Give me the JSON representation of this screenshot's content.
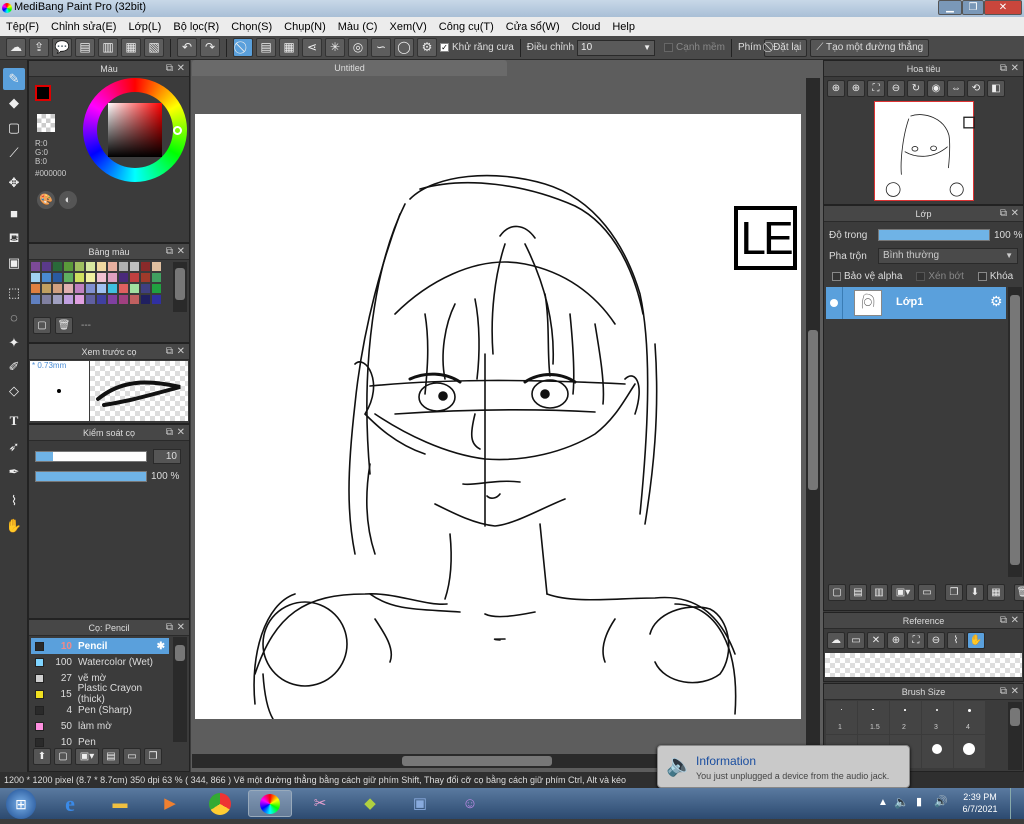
{
  "window": {
    "title": "MediBang Paint Pro (32bit)"
  },
  "menu": [
    "Tệp(F)",
    "Chỉnh sửa(E)",
    "Lớp(L)",
    "Bộ lọc(R)",
    "Chọn(S)",
    "Chụp(N)",
    "Màu (C)",
    "Xem(V)",
    "Công cụ(T)",
    "Cửa sổ(W)",
    "Cloud",
    "Help"
  ],
  "toolbar": {
    "antialias": "Khử răng cưa",
    "adjust_label": "Điều chỉnh",
    "adjust_value": "10",
    "soft_edge": "Cạnh mềm",
    "pen_label": "Phím",
    "reset_label": "Đặt lại",
    "straight_line_label": "Tạo một đường thẳng"
  },
  "color_panel": {
    "title": "Màu",
    "r": "R:0",
    "g": "G:0",
    "b": "B:0",
    "hex": "#000000"
  },
  "palette_panel": {
    "title": "Bảng màu",
    "page": "---"
  },
  "brush_preview": {
    "title": "Xem trước cọ",
    "size": "* 0.73mm"
  },
  "brush_control": {
    "title": "Kiểm soát cọ",
    "size_value": "10",
    "opacity_value": "100 %",
    "size_fill": 0.15,
    "opacity_fill": 1.0
  },
  "brush_list": {
    "title": "Cọ: Pencil",
    "items": [
      {
        "size": "10",
        "name": "Pencil",
        "color": "#2a2a2a",
        "selected": true
      },
      {
        "size": "100",
        "name": "Watercolor (Wet)",
        "color": "#7fd4ff",
        "selected": false
      },
      {
        "size": "27",
        "name": "vẽ mờ",
        "color": "#d0d0d0",
        "selected": false
      },
      {
        "size": "15",
        "name": "Plastic Crayon (thick)",
        "color": "#f0e020",
        "selected": false
      },
      {
        "size": "4",
        "name": "Pen (Sharp)",
        "color": "#2a2a2a",
        "selected": false
      },
      {
        "size": "50",
        "name": "làm mờ",
        "color": "#ff90e0",
        "selected": false
      },
      {
        "size": "10",
        "name": "Pen",
        "color": "#2a2a2a",
        "selected": false
      }
    ]
  },
  "canvas": {
    "tab": "Untitled",
    "logo_text": "LE"
  },
  "navigator": {
    "title": "Hoa tiêu"
  },
  "layer_panel": {
    "title": "Lớp",
    "opacity_label": "Độ trong",
    "opacity_value": "100 %",
    "opacity_fill": 1.0,
    "blend_label": "Pha trộn",
    "blend_value": "Bình thường",
    "protect_alpha": "Bảo vệ alpha",
    "clipping": "Xén bớt",
    "lock": "Khóa",
    "layers": [
      {
        "name": "Lớp1"
      }
    ]
  },
  "reference_panel": {
    "title": "Reference"
  },
  "brush_size_panel": {
    "title": "Brush Size",
    "sizes": [
      "1",
      "1.5",
      "2",
      "3",
      "4",
      "",
      "",
      "",
      "",
      ""
    ]
  },
  "status": {
    "text": "1200 * 1200 pixel  (8.7 * 8.7cm)  350 dpi  63 %  ( 344, 866 )  Vẽ một đường thẳng bằng cách giữ phím Shift, Thay đổi cỡ cọ bằng cách giữ phím Ctrl, Alt và kéo"
  },
  "notification": {
    "title": "Information",
    "message": "You just unplugged a device from the audio jack."
  },
  "taskbar": {
    "time": "2:39 PM",
    "date": "6/7/2021"
  },
  "colors": {
    "accent": "#5aa0dc",
    "panel": "#3b3b3b",
    "canvas_bg": "#5d5d5d"
  }
}
